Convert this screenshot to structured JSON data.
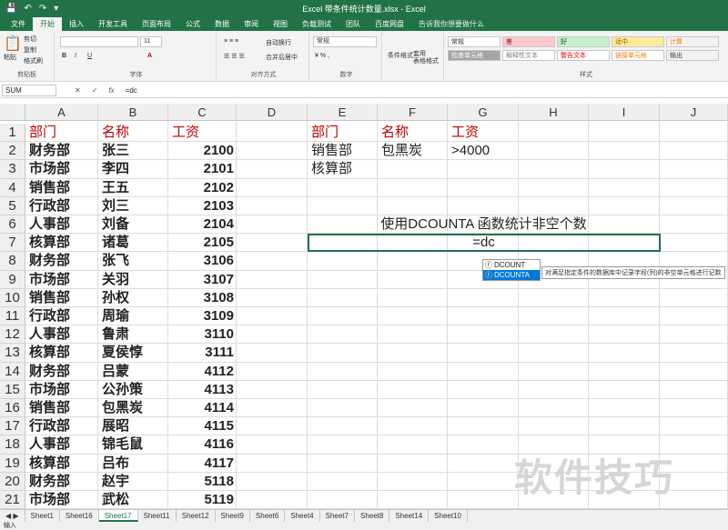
{
  "window": {
    "title": "Excel 带条件统计数量.xlsx - Excel"
  },
  "tabs": [
    "文件",
    "开始",
    "插入",
    "开发工具",
    "页面布局",
    "公式",
    "数据",
    "审阅",
    "视图",
    "负载测试",
    "团队",
    "百度网盘"
  ],
  "active_tab": "开始",
  "tellme": "告诉我你想要做什么",
  "ribbon": {
    "paste": "粘贴",
    "cut": "剪切",
    "copy": "复制",
    "format_painter": "格式刷",
    "clipboard": "剪贴板",
    "font_size": "11",
    "font_group": "字体",
    "wrap": "自动换行",
    "merge": "合并后居中",
    "align_group": "对齐方式",
    "number_format": "常规",
    "number_group": "数字",
    "cond_format": "条件格式",
    "table_format": "套用\n表格格式",
    "styles": [
      {
        "label": "常规",
        "bg": "#ffffff",
        "color": "#333333"
      },
      {
        "label": "差",
        "bg": "#ffc7ce",
        "color": "#9c0006"
      },
      {
        "label": "好",
        "bg": "#c6efce",
        "color": "#006100"
      },
      {
        "label": "适中",
        "bg": "#ffeb9c",
        "color": "#9c5700"
      },
      {
        "label": "计算",
        "bg": "#f2f2f2",
        "color": "#fa7d00"
      },
      {
        "label": "检查单元格",
        "bg": "#a5a5a5",
        "color": "#ffffff"
      },
      {
        "label": "解释性文本",
        "bg": "#ffffff",
        "color": "#7f7f7f"
      },
      {
        "label": "警告文本",
        "bg": "#ffffff",
        "color": "#ff0000"
      },
      {
        "label": "链接单元格",
        "bg": "#ffffff",
        "color": "#fa7d00"
      },
      {
        "label": "输出",
        "bg": "#f2f2f2",
        "color": "#3f3f3f"
      }
    ],
    "styles_group": "样式"
  },
  "formula_bar": {
    "name_box": "SUM",
    "cancel": "✕",
    "enter": "✓",
    "fx": "fx",
    "formula": "=dc"
  },
  "columns": [
    "A",
    "B",
    "C",
    "D",
    "E",
    "F",
    "G",
    "H",
    "I",
    "J"
  ],
  "rows": [
    [
      "部门",
      "名称",
      "工资"
    ],
    [
      "财务部",
      "张三",
      "2100"
    ],
    [
      "市场部",
      "李四",
      "2101"
    ],
    [
      "销售部",
      "王五",
      "2102"
    ],
    [
      "行政部",
      "刘三",
      "2103"
    ],
    [
      "人事部",
      "刘备",
      "2104"
    ],
    [
      "核算部",
      "诸葛",
      "2105"
    ],
    [
      "财务部",
      "张飞",
      "3106"
    ],
    [
      "市场部",
      "关羽",
      "3107"
    ],
    [
      "销售部",
      "孙权",
      "3108"
    ],
    [
      "行政部",
      "周瑜",
      "3109"
    ],
    [
      "人事部",
      "鲁肃",
      "3110"
    ],
    [
      "核算部",
      "夏侯惇",
      "3111"
    ],
    [
      "财务部",
      "吕蒙",
      "4112"
    ],
    [
      "市场部",
      "公孙策",
      "4113"
    ],
    [
      "销售部",
      "包黑炭",
      "4114"
    ],
    [
      "行政部",
      "展昭",
      "4115"
    ],
    [
      "人事部",
      "锦毛鼠",
      "4116"
    ],
    [
      "核算部",
      "吕布",
      "4117"
    ],
    [
      "财务部",
      "赵宇",
      "5118"
    ],
    [
      "市场部",
      "武松",
      "5119"
    ]
  ],
  "criteria": {
    "header": [
      "部门",
      "名称",
      "工资"
    ],
    "row2": [
      "销售部",
      "包黑炭",
      ">4000"
    ],
    "row3": [
      "核算部"
    ]
  },
  "note": "使用DCOUNTA 函数统计非空个数",
  "active_cell_value": "=dc",
  "autocomplete": {
    "items": [
      "DCOUNT",
      "DCOUNTA"
    ],
    "selected": "DCOUNTA",
    "tooltip": "对满足指定条件的数据库中记录字段(列)的非空单元格进行记数"
  },
  "sheets": [
    "Sheet1",
    "Sheet16",
    "Sheet17",
    "Sheet11",
    "Sheet12",
    "Sheet9",
    "Sheet6",
    "Sheet4",
    "Sheet7",
    "Sheet8",
    "Sheet14",
    "Sheet10"
  ],
  "active_sheet": "Sheet17",
  "status": "输入",
  "watermark": "软件技巧",
  "accent": "#217346",
  "header_color": "#c00000"
}
